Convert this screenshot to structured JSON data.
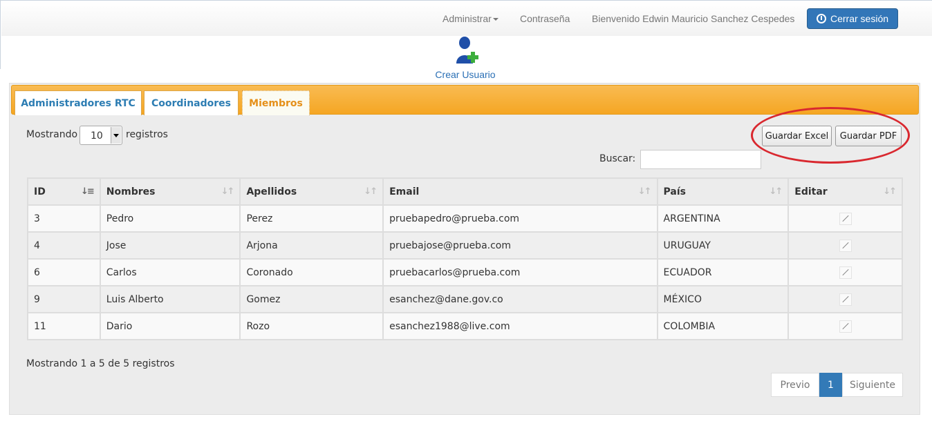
{
  "nav": {
    "admin": "Administrar",
    "password": "Contraseña",
    "welcome": "Bienvenido Edwin Mauricio Sanchez Cespedes",
    "logout": "Cerrar sesión"
  },
  "create_user": {
    "label": "Crear Usuario",
    "icon": "user-add-icon"
  },
  "tabs": [
    {
      "label": "Administradores RTC",
      "active": false
    },
    {
      "label": "Coordinadores",
      "active": false
    },
    {
      "label": "Miembros",
      "active": true
    }
  ],
  "length": {
    "prefix": "Mostrando",
    "value": "10",
    "suffix": "registros"
  },
  "buttons": {
    "excel": "Guardar Excel",
    "pdf": "Guardar PDF"
  },
  "search": {
    "label": "Buscar:",
    "value": ""
  },
  "table": {
    "headers": [
      "ID",
      "Nombres",
      "Apellidos",
      "Email",
      "País",
      "Editar"
    ],
    "rows": [
      [
        "3",
        "Pedro",
        "Perez",
        "pruebapedro@prueba.com",
        "ARGENTINA"
      ],
      [
        "4",
        "Jose",
        "Arjona",
        "pruebajose@prueba.com",
        "URUGUAY"
      ],
      [
        "6",
        "Carlos",
        "Coronado",
        "pruebacarlos@prueba.com",
        "ECUADOR"
      ],
      [
        "9",
        "Luis Alberto",
        "Gomez",
        "esanchez@dane.gov.co",
        "MÉXICO"
      ],
      [
        "11",
        "Dario",
        "Rozo",
        "esanchez1988@live.com",
        "COLOMBIA"
      ]
    ]
  },
  "info": "Mostrando 1 a 5 de 5 registros",
  "pagination": {
    "prev": "Previo",
    "current": "1",
    "next": "Siguiente"
  },
  "colors": {
    "accent": "#f5a623",
    "primary": "#337ab7",
    "highlight": "#d9282f"
  }
}
